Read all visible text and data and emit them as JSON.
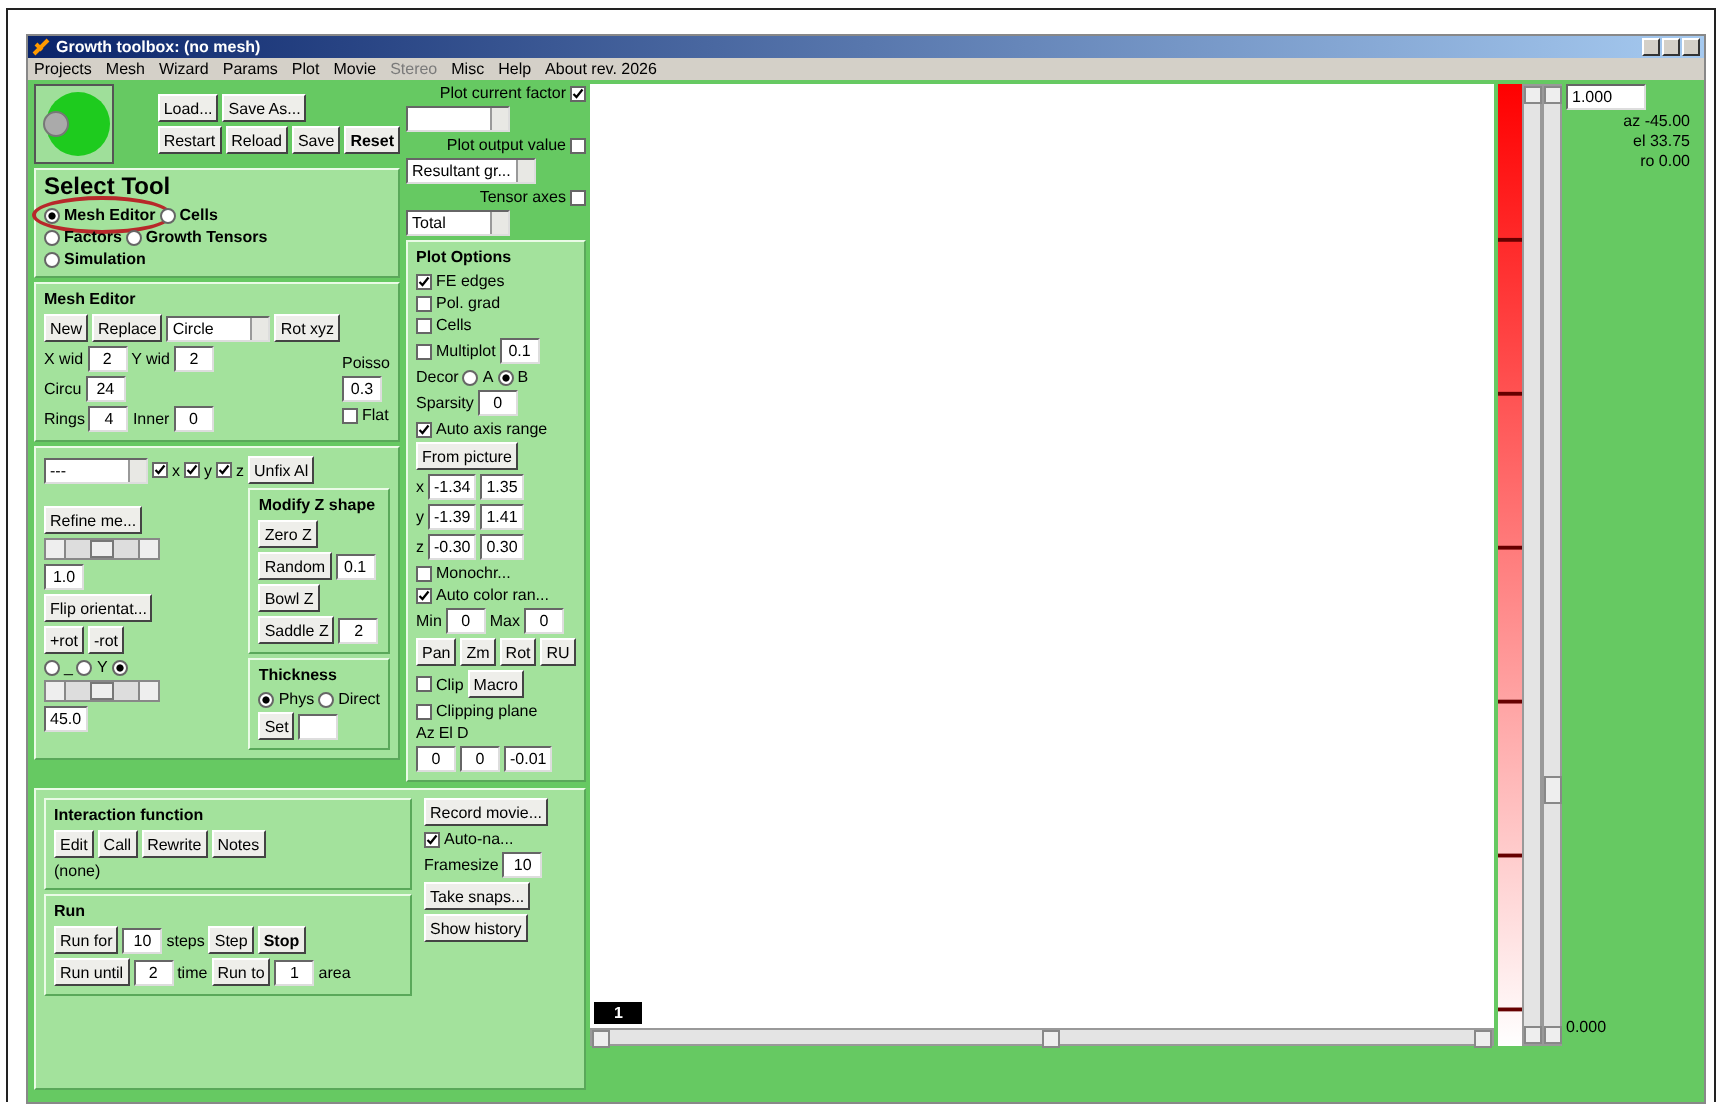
{
  "window": {
    "title": "Growth toolbox: (no mesh)"
  },
  "menu": [
    {
      "label": "Projects",
      "disabled": false
    },
    {
      "label": "Mesh",
      "disabled": false
    },
    {
      "label": "Wizard",
      "disabled": false
    },
    {
      "label": "Params",
      "disabled": false
    },
    {
      "label": "Plot",
      "disabled": false
    },
    {
      "label": "Movie",
      "disabled": false
    },
    {
      "label": "Stereo",
      "disabled": true
    },
    {
      "label": "Misc",
      "disabled": false
    },
    {
      "label": "Help",
      "disabled": false
    },
    {
      "label": "About rev. 2026",
      "disabled": false
    }
  ],
  "left": [
    {
      "items": [
        {
          "kind": "logo"
        },
        {
          "kind": "stack",
          "lines": [
            {
              "items": [
                {
                  "kind": "button",
                  "label": "Load..."
                },
                {
                  "kind": "button",
                  "label": "Save As..."
                }
              ]
            },
            {
              "items": [
                {
                  "kind": "button",
                  "label": "Restart"
                },
                {
                  "kind": "button",
                  "label": "Reload"
                },
                {
                  "kind": "button",
                  "label": "Save"
                },
                {
                  "kind": "button",
                  "label": "Reset",
                  "bold": true
                }
              ]
            }
          ]
        }
      ]
    },
    {
      "items": [
        {
          "kind": "group",
          "title": "Select Tool",
          "large": true,
          "lines": [
            {
              "items": [
                {
                  "kind": "radio",
                  "label": "Mesh Editor",
                  "selected": true,
                  "circled": true
                },
                {
                  "kind": "radio",
                  "label": "Cells",
                  "selected": false
                }
              ]
            },
            {
              "items": [
                {
                  "kind": "radio",
                  "label": "Factors",
                  "selected": false
                },
                {
                  "kind": "radio",
                  "label": "Growth Tensors",
                  "selected": false
                }
              ]
            },
            {
              "items": [
                {
                  "kind": "radio",
                  "label": "Simulation",
                  "selected": false
                }
              ]
            }
          ]
        }
      ]
    },
    {
      "items": [
        {
          "kind": "group",
          "title": "Mesh Editor",
          "lines": [
            {
              "items": [
                {
                  "kind": "button",
                  "label": "New"
                },
                {
                  "kind": "button",
                  "label": "Replace"
                },
                {
                  "kind": "dropdown",
                  "value": "Circle"
                },
                {
                  "kind": "button",
                  "label": "Rot xyz"
                }
              ]
            },
            {
              "items": [
                {
                  "kind": "stack",
                  "lines": [
                    {
                      "items": [
                        {
                          "kind": "label",
                          "text": "X wid"
                        },
                        {
                          "kind": "field",
                          "value": "2"
                        },
                        {
                          "kind": "label",
                          "text": "Y wid"
                        },
                        {
                          "kind": "field",
                          "value": "2"
                        }
                      ]
                    },
                    {
                      "items": [
                        {
                          "kind": "label",
                          "text": "Circu"
                        },
                        {
                          "kind": "field",
                          "value": "24"
                        }
                      ]
                    },
                    {
                      "items": [
                        {
                          "kind": "label",
                          "text": "Rings"
                        },
                        {
                          "kind": "field",
                          "value": "4"
                        },
                        {
                          "kind": "label",
                          "text": "Inner"
                        },
                        {
                          "kind": "field",
                          "value": "0"
                        }
                      ]
                    }
                  ]
                },
                {
                  "kind": "stack",
                  "lines": [
                    {
                      "items": [
                        {
                          "kind": "label",
                          "text": "Poisso"
                        }
                      ]
                    },
                    {
                      "items": [
                        {
                          "kind": "field",
                          "value": "0.3"
                        }
                      ]
                    },
                    {
                      "items": [
                        {
                          "kind": "check",
                          "label": "Flat",
                          "checked": false
                        }
                      ]
                    }
                  ]
                }
              ]
            }
          ]
        }
      ]
    },
    {
      "items": [
        {
          "kind": "group",
          "lines": [
            {
              "items": [
                {
                  "kind": "dropdown",
                  "value": "---"
                },
                {
                  "kind": "check",
                  "label": "x",
                  "checked": true
                },
                {
                  "kind": "check",
                  "label": "y",
                  "checked": true
                },
                {
                  "kind": "check",
                  "label": "z",
                  "checked": true
                },
                {
                  "kind": "button",
                  "label": "Unfix Al"
                }
              ]
            },
            {
              "items": [
                {
                  "kind": "stack",
                  "lines": [
                    {
                      "items": [
                        {
                          "kind": "button",
                          "label": "Refine me..."
                        }
                      ]
                    },
                    {
                      "items": [
                        {
                          "kind": "slider",
                          "level": 0.5
                        }
                      ]
                    },
                    {
                      "items": [
                        {
                          "kind": "field",
                          "value": "1.0"
                        }
                      ]
                    },
                    {
                      "items": [
                        {
                          "kind": "button",
                          "label": "Flip orientat..."
                        }
                      ]
                    },
                    {
                      "items": [
                        {
                          "kind": "button",
                          "label": "+rot"
                        },
                        {
                          "kind": "button",
                          "label": "-rot"
                        }
                      ]
                    },
                    {
                      "items": [
                        {
                          "kind": "radio",
                          "label": "_",
                          "selected": false
                        },
                        {
                          "kind": "radio",
                          "label": "Y",
                          "selected": false
                        },
                        {
                          "kind": "radio",
                          "selected": true
                        }
                      ]
                    },
                    {
                      "items": [
                        {
                          "kind": "slider",
                          "level": 0.5
                        }
                      ]
                    },
                    {
                      "items": [
                        {
                          "kind": "field",
                          "value": "45.0"
                        }
                      ]
                    }
                  ]
                },
                {
                  "kind": "stack",
                  "lines": [
                    {
                      "items": [
                        {
                          "kind": "group",
                          "title": "Modify Z shape",
                          "lines": [
                            {
                              "items": [
                                {
                                  "kind": "button",
                                  "label": "Zero Z"
                                }
                              ]
                            },
                            {
                              "items": [
                                {
                                  "kind": "button",
                                  "label": "Random"
                                },
                                {
                                  "kind": "field",
                                  "value": "0.1"
                                }
                              ]
                            },
                            {
                              "items": [
                                {
                                  "kind": "button",
                                  "label": "Bowl Z"
                                }
                              ]
                            },
                            {
                              "items": [
                                {
                                  "kind": "button",
                                  "label": "Saddle Z"
                                },
                                {
                                  "kind": "field",
                                  "value": "2"
                                }
                              ]
                            }
                          ]
                        }
                      ]
                    },
                    {
                      "items": [
                        {
                          "kind": "group",
                          "title": "Thickness",
                          "lines": [
                            {
                              "items": [
                                {
                                  "kind": "radio",
                                  "label": "Phys",
                                  "selected": true
                                },
                                {
                                  "kind": "radio",
                                  "label": "Direct",
                                  "selected": false
                                }
                              ]
                            },
                            {
                              "items": [
                                {
                                  "kind": "button",
                                  "label": "Set"
                                },
                                {
                                  "kind": "field"
                                }
                              ]
                            }
                          ]
                        }
                      ]
                    }
                  ]
                }
              ]
            }
          ]
        }
      ]
    }
  ],
  "middle": [
    {
      "items": [
        {
          "kind": "check",
          "label": "Plot current factor",
          "checked": true,
          "box_after": true
        }
      ]
    },
    {
      "items": [
        {
          "kind": "dropdown"
        }
      ]
    },
    {
      "items": [
        {
          "kind": "check",
          "label": "Plot output value",
          "checked": false,
          "box_after": true
        }
      ]
    },
    {
      "items": [
        {
          "kind": "dropdown",
          "value": "Resultant gr..."
        }
      ]
    },
    {
      "items": [
        {
          "kind": "check",
          "label": "Tensor axes",
          "checked": false,
          "box_after": true
        }
      ]
    },
    {
      "items": [
        {
          "kind": "dropdown",
          "value": "Total"
        }
      ]
    },
    {
      "items": [
        {
          "kind": "group",
          "title": "Plot Options",
          "lines": [
            {
              "items": [
                {
                  "kind": "check",
                  "label": "FE edges",
                  "checked": true
                }
              ]
            },
            {
              "items": [
                {
                  "kind": "check",
                  "label": "Pol. grad",
                  "checked": false
                }
              ]
            },
            {
              "items": [
                {
                  "kind": "check",
                  "label": "Cells",
                  "checked": false
                }
              ]
            },
            {
              "items": [
                {
                  "kind": "check",
                  "label": "Multiplot",
                  "checked": false
                },
                {
                  "kind": "field",
                  "value": "0.1"
                }
              ]
            },
            {
              "items": [
                {
                  "kind": "label",
                  "text": "Decor"
                },
                {
                  "kind": "radio",
                  "label": "A",
                  "selected": false
                },
                {
                  "kind": "radio",
                  "label": "B",
                  "selected": true
                }
              ]
            },
            {
              "items": [
                {
                  "kind": "label",
                  "text": "Sparsity"
                },
                {
                  "kind": "field",
                  "value": "0"
                }
              ]
            },
            {
              "items": [
                {
                  "kind": "check",
                  "label": "Auto axis range",
                  "checked": true
                }
              ]
            },
            {
              "items": [
                {
                  "kind": "button",
                  "label": "From picture"
                }
              ]
            },
            {
              "items": [
                {
                  "kind": "label",
                  "text": "x"
                },
                {
                  "kind": "field",
                  "value": "-1.34"
                },
                {
                  "kind": "field",
                  "value": "1.35"
                }
              ]
            },
            {
              "items": [
                {
                  "kind": "label",
                  "text": "y"
                },
                {
                  "kind": "field",
                  "value": "-1.39"
                },
                {
                  "kind": "field",
                  "value": "1.41"
                }
              ]
            },
            {
              "items": [
                {
                  "kind": "label",
                  "text": "z"
                },
                {
                  "kind": "field",
                  "value": "-0.30"
                },
                {
                  "kind": "field",
                  "value": "0.30"
                }
              ]
            },
            {
              "items": [
                {
                  "kind": "check",
                  "label": "Monochr...",
                  "checked": false
                }
              ]
            },
            {
              "items": [
                {
                  "kind": "check",
                  "label": "Auto color ran...",
                  "checked": true
                }
              ]
            },
            {
              "items": [
                {
                  "kind": "label",
                  "text": "Min"
                },
                {
                  "kind": "field",
                  "value": "0"
                },
                {
                  "kind": "label",
                  "text": "Max"
                },
                {
                  "kind": "field",
                  "value": "0"
                }
              ]
            },
            {
              "items": [
                {
                  "kind": "button",
                  "label": "Pan"
                },
                {
                  "kind": "button",
                  "label": "Zm"
                },
                {
                  "kind": "button",
                  "label": "Rot"
                },
                {
                  "kind": "button",
                  "label": "RU"
                }
              ]
            },
            {
              "items": [
                {
                  "kind": "check",
                  "label": "Clip",
                  "checked": false
                },
                {
                  "kind": "button",
                  "label": "Macro"
                }
              ]
            },
            {
              "items": [
                {
                  "kind": "check",
                  "label": "Clipping plane",
                  "checked": false
                }
              ]
            },
            {
              "items": [
                {
                  "kind": "label",
                  "text": "Az"
                },
                {
                  "kind": "label",
                  "text": "El"
                },
                {
                  "kind": "label",
                  "text": "D"
                }
              ]
            },
            {
              "items": [
                {
                  "kind": "field",
                  "value": "0"
                },
                {
                  "kind": "field",
                  "value": "0"
                },
                {
                  "kind": "field",
                  "value": "-0.01"
                }
              ]
            }
          ]
        }
      ]
    }
  ],
  "bottom_left": [
    {
      "items": [
        {
          "kind": "group",
          "title": "Interaction function",
          "lines": [
            {
              "items": [
                {
                  "kind": "button",
                  "label": "Edit"
                },
                {
                  "kind": "button",
                  "label": "Call"
                },
                {
                  "kind": "button",
                  "label": "Rewrite"
                },
                {
                  "kind": "button",
                  "label": "Notes"
                }
              ]
            },
            {
              "items": [
                {
                  "kind": "label",
                  "text": "(none)"
                }
              ]
            }
          ]
        }
      ]
    },
    {
      "items": [
        {
          "kind": "group",
          "title": "Run",
          "lines": [
            {
              "items": [
                {
                  "kind": "button",
                  "label": "Run for"
                },
                {
                  "kind": "field",
                  "value": "10"
                },
                {
                  "kind": "label",
                  "text": "steps"
                },
                {
                  "kind": "button",
                  "label": "Step"
                },
                {
                  "kind": "button",
                  "label": "Stop",
                  "bold": true
                }
              ]
            },
            {
              "items": [
                {
                  "kind": "button",
                  "label": "Run until"
                },
                {
                  "kind": "field",
                  "value": "2"
                },
                {
                  "kind": "label",
                  "text": "time"
                },
                {
                  "kind": "button",
                  "label": "Run to"
                },
                {
                  "kind": "field",
                  "value": "1"
                },
                {
                  "kind": "label",
                  "text": "area"
                }
              ]
            }
          ]
        }
      ]
    }
  ],
  "bottom_right": [
    {
      "items": [
        {
          "kind": "button",
          "label": "Record movie..."
        }
      ]
    },
    {
      "items": [
        {
          "kind": "check",
          "label": "Auto-na...",
          "checked": true
        }
      ]
    },
    {
      "items": [
        {
          "kind": "label",
          "text": "Framesize"
        },
        {
          "kind": "field",
          "value": "10"
        }
      ]
    },
    {
      "items": [
        {
          "kind": "button",
          "label": "Take snaps..."
        }
      ]
    },
    {
      "items": [
        {
          "kind": "button",
          "label": "Show history"
        }
      ]
    }
  ],
  "canvas": {
    "frame_label": "1"
  },
  "colorbar": {
    "max": "1.000",
    "min": "0.000"
  },
  "view": [
    "az -45.00",
    "el 33.75",
    "ro 0.00"
  ]
}
